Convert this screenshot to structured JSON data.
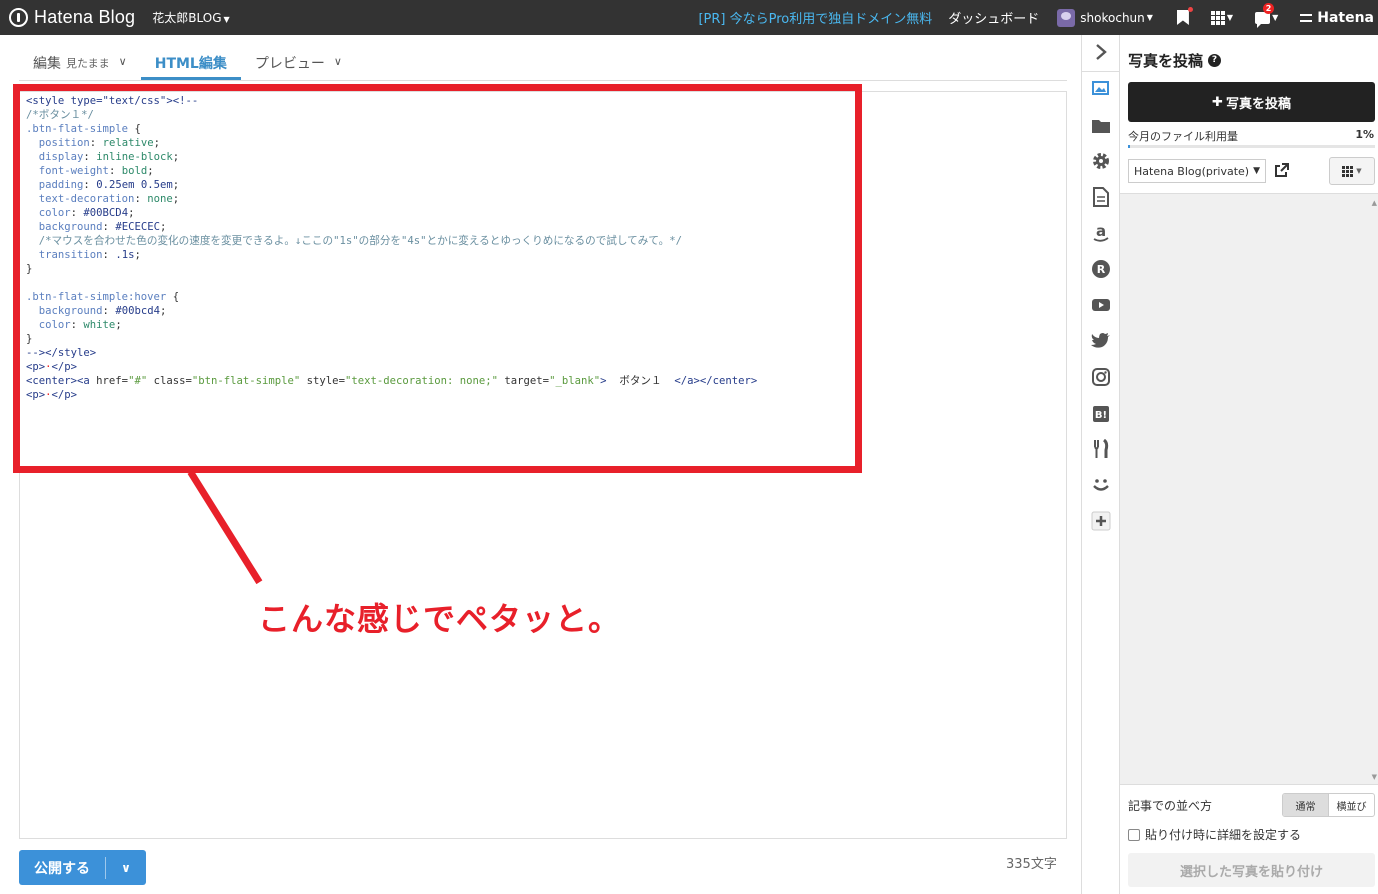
{
  "topbar": {
    "logo_text": "Hatena Blog",
    "blog_name": "花太郎BLOG",
    "pr_link": "[PR] 今ならPro利用で独自ドメイン無料",
    "dashboard": "ダッシュボード",
    "username": "shokochun",
    "notification_count": "2",
    "brand": "Hatena"
  },
  "tabs": [
    {
      "label": "編集",
      "sub": "見たまま"
    },
    {
      "label": "HTML編集",
      "sub": ""
    },
    {
      "label": "プレビュー",
      "sub": ""
    }
  ],
  "editor": {
    "lines": [
      [
        [
          "c-tag",
          "<style type=\"text/css\"><!--"
        ]
      ],
      [
        [
          "c-cmt",
          "/*ボタン１*/"
        ]
      ],
      [
        [
          "c-prop",
          ".btn-flat-simple"
        ],
        [
          "c-plain",
          " {"
        ]
      ],
      [
        [
          "c-plain",
          "  "
        ],
        [
          "c-prop",
          "position"
        ],
        [
          "c-plain",
          ": "
        ],
        [
          "c-val",
          "relative"
        ],
        [
          "c-plain",
          ";"
        ]
      ],
      [
        [
          "c-plain",
          "  "
        ],
        [
          "c-prop",
          "display"
        ],
        [
          "c-plain",
          ": "
        ],
        [
          "c-val",
          "inline-block"
        ],
        [
          "c-plain",
          ";"
        ]
      ],
      [
        [
          "c-plain",
          "  "
        ],
        [
          "c-prop",
          "font-weight"
        ],
        [
          "c-plain",
          ": "
        ],
        [
          "c-val",
          "bold"
        ],
        [
          "c-plain",
          ";"
        ]
      ],
      [
        [
          "c-plain",
          "  "
        ],
        [
          "c-prop",
          "padding"
        ],
        [
          "c-plain",
          ": "
        ],
        [
          "c-tag",
          "0.25em 0.5em"
        ],
        [
          "c-plain",
          ";"
        ]
      ],
      [
        [
          "c-plain",
          "  "
        ],
        [
          "c-prop",
          "text-decoration"
        ],
        [
          "c-plain",
          ": "
        ],
        [
          "c-val",
          "none"
        ],
        [
          "c-plain",
          ";"
        ]
      ],
      [
        [
          "c-plain",
          "  "
        ],
        [
          "c-prop",
          "color"
        ],
        [
          "c-plain",
          ": "
        ],
        [
          "c-tag",
          "#00BCD4"
        ],
        [
          "c-plain",
          ";"
        ]
      ],
      [
        [
          "c-plain",
          "  "
        ],
        [
          "c-prop",
          "background"
        ],
        [
          "c-plain",
          ": "
        ],
        [
          "c-tag",
          "#ECECEC"
        ],
        [
          "c-plain",
          ";"
        ]
      ],
      [
        [
          "c-plain",
          "  "
        ],
        [
          "c-cmt",
          "/*マウスを合わせた色の変化の速度を変更できるよ。↓ここの\"1s\"の部分を\"4s\"とかに変えるとゆっくりめになるので試してみて。*/"
        ]
      ],
      [
        [
          "c-plain",
          "  "
        ],
        [
          "c-prop",
          "transition"
        ],
        [
          "c-plain",
          ": "
        ],
        [
          "c-tag",
          ".1s"
        ],
        [
          "c-plain",
          ";"
        ]
      ],
      [
        [
          "c-plain",
          "}"
        ]
      ],
      [
        [
          "c-plain",
          ""
        ]
      ],
      [
        [
          "c-prop",
          ".btn-flat-simple:hover"
        ],
        [
          "c-plain",
          " {"
        ]
      ],
      [
        [
          "c-plain",
          "  "
        ],
        [
          "c-prop",
          "background"
        ],
        [
          "c-plain",
          ": "
        ],
        [
          "c-tag",
          "#00bcd4"
        ],
        [
          "c-plain",
          ";"
        ]
      ],
      [
        [
          "c-plain",
          "  "
        ],
        [
          "c-prop",
          "color"
        ],
        [
          "c-plain",
          ": "
        ],
        [
          "c-val",
          "white"
        ],
        [
          "c-plain",
          ";"
        ]
      ],
      [
        [
          "c-plain",
          "}"
        ]
      ],
      [
        [
          "c-tag",
          "--></style>"
        ]
      ],
      [
        [
          "c-tag",
          "<p>"
        ],
        [
          "c-red",
          "·"
        ],
        [
          "c-tag",
          "</p>"
        ]
      ],
      [
        [
          "c-tag",
          "<center><a "
        ],
        [
          "c-plain",
          "href="
        ],
        [
          "c-str",
          "\"#\""
        ],
        [
          "c-plain",
          " class="
        ],
        [
          "c-str",
          "\"btn-flat-simple\""
        ],
        [
          "c-plain",
          " style="
        ],
        [
          "c-str",
          "\"text-decoration: none;\""
        ],
        [
          "c-plain",
          " target="
        ],
        [
          "c-str",
          "\"_blank\""
        ],
        [
          "c-tag",
          ">"
        ],
        [
          "c-plain",
          "  ボタン１  "
        ],
        [
          "c-tag",
          "</a></center>"
        ]
      ],
      [
        [
          "c-tag",
          "<p>"
        ],
        [
          "c-red",
          "·"
        ],
        [
          "c-tag",
          "</p>"
        ]
      ]
    ]
  },
  "annotation": "こんな感じでペタッと。",
  "bottom": {
    "publish_label": "公開する",
    "char_count": "335文字"
  },
  "panel": {
    "title": "写真を投稿",
    "post_button": "写真を投稿",
    "usage_label": "今月のファイル利用量",
    "usage_percent": "1%",
    "usage_fraction": 0.01,
    "blog_select_value": "Hatena Blog(private)",
    "sort_label": "記事での並べ方",
    "sort_options": [
      "通常",
      "横並び"
    ],
    "detail_checkbox": "貼り付け時に詳細を設定する",
    "paste_button": "選択した写真を貼り付け"
  },
  "colors": {
    "accent": "#3c91d9",
    "annotation_red": "#e8202a",
    "topbar": "#333333"
  }
}
